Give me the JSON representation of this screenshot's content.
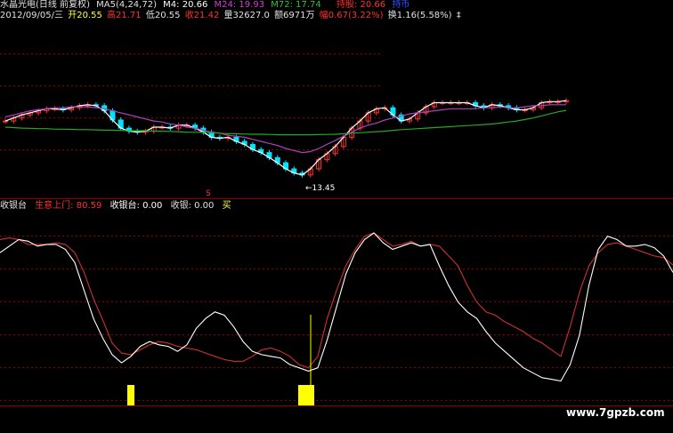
{
  "colors": {
    "background": "#000000",
    "grid": "#8b0000",
    "candle_up": "#ff3030",
    "candle_down": "#00e5ff",
    "ma_short": "#ffffff",
    "ma_mid": "#b040c0",
    "ma_long": "#22aa22",
    "osc_white": "#ffffff",
    "osc_red": "#d03030",
    "bars": "#ffff00"
  },
  "header": {
    "stock": "水晶光电(日线 前复权)",
    "ma_param": "MA5(4,24,72)",
    "ma4": "M4: 20.66",
    "ma24": "M24: 19.93",
    "ma72": "M72: 17.74",
    "hold": "持股: 20.66",
    "signal": "持币",
    "date": "2012/09/05/三",
    "open": "开20.55",
    "high": "高21.71",
    "low": "低20.55",
    "close": "收21.42",
    "volume": "量32627.0",
    "amount": "额6971万",
    "change": "幅0.67(3.22%)",
    "turnover": "换1.16(5.58%)",
    "end_mark": "‡"
  },
  "indicator_header": {
    "name": "收银台",
    "line1": "生意上门: 80.59",
    "line2": "收银台: 0.00",
    "line3": "收银: 0.00",
    "line4": "买"
  },
  "annotations": {
    "low_price": "←13.45",
    "sell_mark": "S"
  },
  "watermark": "www.7gpzb.com",
  "chart_data": [
    {
      "type": "line",
      "title": "",
      "series": [
        {
          "name": "MA5(4,24,72)",
          "values": [
            19.3,
            19.6,
            19.9,
            20.1,
            20.3,
            20.5,
            20.5,
            20.4,
            20.6,
            20.8,
            20.9,
            20.8,
            20.3,
            19.4,
            18.6,
            18.3,
            18.2,
            18.3,
            18.7,
            18.7,
            18.6,
            18.9,
            18.9,
            18.6,
            18.2,
            17.7,
            17.6,
            17.7,
            17.3,
            17.0,
            16.5,
            16.2,
            15.7,
            15.2,
            14.6,
            14.2,
            14.0,
            14.6,
            15.5,
            16.1,
            16.8,
            17.7,
            18.6,
            19.3,
            20.1,
            20.5,
            20.6,
            19.9,
            19.3,
            19.5,
            20.1,
            20.7,
            21.1,
            21.1,
            21.1,
            21.1,
            21.1,
            20.8,
            20.6,
            20.9,
            20.8,
            20.6,
            20.4,
            20.4,
            20.6,
            21.1,
            21.2,
            21.2,
            21.3
          ]
        },
        {
          "name": "M24",
          "values": [
            19.7,
            19.9,
            20.1,
            20.3,
            20.4,
            20.5,
            20.6,
            20.6,
            20.7,
            20.7,
            20.7,
            20.6,
            20.5,
            20.3,
            20.1,
            19.9,
            19.7,
            19.5,
            19.3,
            19.2,
            19.0,
            18.9,
            18.7,
            18.6,
            18.4,
            18.2,
            18.1,
            17.9,
            17.8,
            17.7,
            17.5,
            17.3,
            17.1,
            16.9,
            16.6,
            16.4,
            16.2,
            16.3,
            16.6,
            17.0,
            17.4,
            17.8,
            18.2,
            18.6,
            18.9,
            19.1,
            19.4,
            19.6,
            19.8,
            20.0,
            20.1,
            20.2,
            20.3,
            20.4,
            20.5,
            20.5,
            20.5,
            20.5,
            20.6,
            20.6,
            20.7,
            20.6,
            20.6,
            20.7,
            20.8,
            20.8,
            20.9,
            20.9,
            20.9
          ]
        },
        {
          "name": "M72",
          "values": [
            18.7,
            18.65,
            18.6,
            18.58,
            18.55,
            18.55,
            18.5,
            18.5,
            18.48,
            18.45,
            18.45,
            18.43,
            18.4,
            18.4,
            18.38,
            18.35,
            18.35,
            18.35,
            18.3,
            18.3,
            18.28,
            18.25,
            18.2,
            18.2,
            18.18,
            18.15,
            18.1,
            18.05,
            18.05,
            18.02,
            18.0,
            18.0,
            17.98,
            17.95,
            17.95,
            17.95,
            17.95,
            17.95,
            17.96,
            17.98,
            18.0,
            18.05,
            18.1,
            18.15,
            18.2,
            18.25,
            18.3,
            18.38,
            18.45,
            18.5,
            18.55,
            18.6,
            18.65,
            18.7,
            18.75,
            18.8,
            18.85,
            18.9,
            18.95,
            19.0,
            19.1,
            19.2,
            19.3,
            19.45,
            19.6,
            19.8,
            20.0,
            20.2,
            20.35
          ]
        }
      ],
      "low_value": 13.45
    },
    {
      "type": "line",
      "title": "",
      "ylim": [
        0,
        100
      ],
      "series": [
        {
          "name": "生意上门",
          "values": [
            96,
            97,
            96,
            93,
            93,
            93,
            94,
            93,
            88,
            76,
            60,
            47,
            33,
            27,
            26,
            29,
            32,
            34,
            33,
            31,
            30,
            29,
            27,
            25,
            23,
            22,
            22,
            25,
            29,
            30,
            28,
            25,
            20,
            18,
            25,
            48,
            65,
            80,
            90,
            98,
            100,
            96,
            92,
            93,
            95,
            92,
            93,
            92,
            86,
            80,
            68,
            58,
            52,
            50,
            46,
            43,
            40,
            36,
            33,
            29,
            25,
            43,
            64,
            80,
            88,
            93,
            94,
            92,
            90,
            88,
            86,
            85,
            80.59
          ]
        },
        {
          "name": "收银台",
          "values": [
            88,
            92,
            96,
            95,
            92,
            93,
            93,
            90,
            82,
            65,
            48,
            36,
            26,
            21,
            25,
            31,
            34,
            32,
            31,
            28,
            32,
            42,
            48,
            52,
            50,
            43,
            34,
            28,
            26,
            25,
            24,
            20,
            18,
            16,
            18,
            35,
            55,
            75,
            88,
            96,
            100,
            94,
            90,
            92,
            94,
            92,
            93,
            80,
            68,
            58,
            52,
            48,
            40,
            33,
            28,
            23,
            18,
            15,
            12,
            11,
            10,
            20,
            38,
            68,
            90,
            98,
            96,
            92,
            92,
            93,
            91,
            86,
            76
          ]
        }
      ]
    }
  ]
}
